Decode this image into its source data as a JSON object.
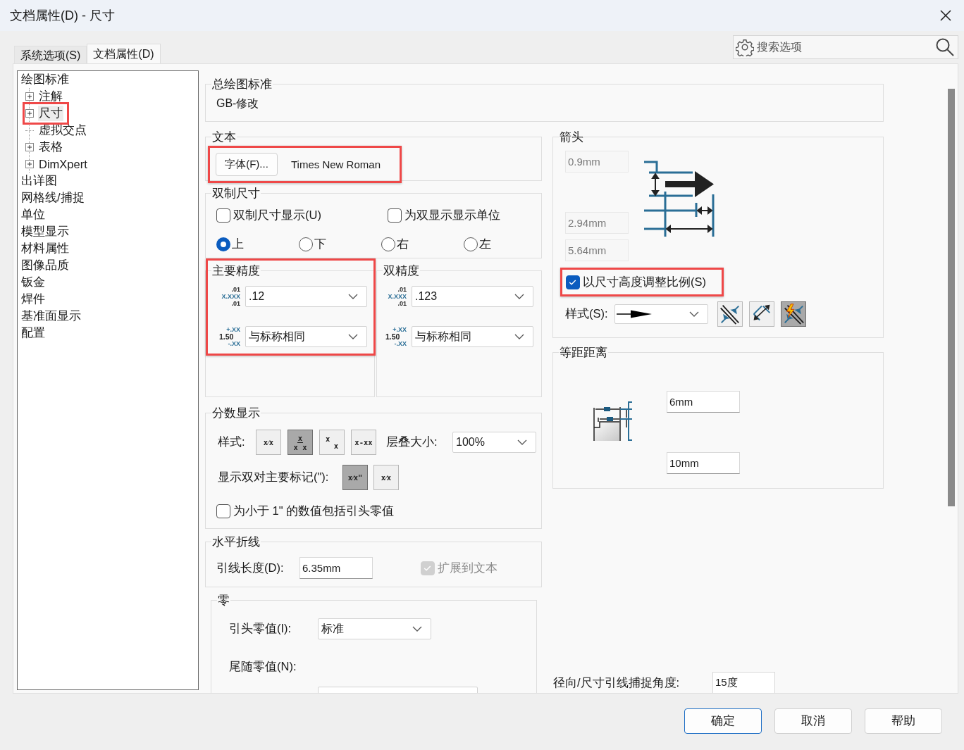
{
  "window": {
    "title": "文档属性(D) - 尺寸"
  },
  "tabs": [
    {
      "label": "系统选项(S)",
      "selected": false
    },
    {
      "label": "文档属性(D)",
      "selected": true
    }
  ],
  "search": {
    "placeholder": "搜索选项"
  },
  "tree": {
    "items": [
      {
        "label": "绘图标准",
        "expandable": false,
        "selected": false,
        "highlighted": false,
        "children": [
          {
            "label": "注解",
            "expandable": true,
            "selected": false,
            "highlighted": false
          },
          {
            "label": "尺寸",
            "expandable": true,
            "selected": true,
            "highlighted": true
          },
          {
            "label": "虚拟交点",
            "expandable": false,
            "selected": false,
            "highlighted": false
          },
          {
            "label": "表格",
            "expandable": true,
            "selected": false,
            "highlighted": false
          },
          {
            "label": "DimXpert",
            "expandable": true,
            "selected": false,
            "highlighted": false
          }
        ]
      },
      {
        "label": "出详图",
        "expandable": false,
        "selected": false,
        "highlighted": false
      },
      {
        "label": "网格线/捕捉",
        "expandable": false,
        "selected": false,
        "highlighted": false
      },
      {
        "label": "单位",
        "expandable": false,
        "selected": false,
        "highlighted": false
      },
      {
        "label": "模型显示",
        "expandable": false,
        "selected": false,
        "highlighted": false
      },
      {
        "label": "材料属性",
        "expandable": false,
        "selected": false,
        "highlighted": false
      },
      {
        "label": "图像品质",
        "expandable": false,
        "selected": false,
        "highlighted": false
      },
      {
        "label": "钣金",
        "expandable": false,
        "selected": false,
        "highlighted": false
      },
      {
        "label": "焊件",
        "expandable": false,
        "selected": false,
        "highlighted": false
      },
      {
        "label": "基准面显示",
        "expandable": false,
        "selected": false,
        "highlighted": false
      },
      {
        "label": "配置",
        "expandable": false,
        "selected": false,
        "highlighted": false
      }
    ]
  },
  "general_standard": {
    "title": "总绘图标准",
    "value": "GB-修改"
  },
  "text": {
    "title": "文本",
    "font_button": "字体(F)...",
    "font_name": "Times New Roman",
    "highlighted": true
  },
  "dual_dimensions": {
    "title": "双制尺寸",
    "checkboxes": [
      {
        "label": "双制尺寸显示(U)",
        "checked": false
      },
      {
        "label": "为双显示显示单位",
        "checked": false
      }
    ],
    "positions": [
      {
        "label": "上",
        "selected": true
      },
      {
        "label": "下",
        "selected": false
      },
      {
        "label": "右",
        "selected": false
      },
      {
        "label": "左",
        "selected": false
      }
    ]
  },
  "precision": [
    {
      "title": "主要精度",
      "highlighted": true,
      "value_icon": [
        ".01",
        "X.XXX",
        ".01"
      ],
      "value": ".12",
      "tolerance_icon": [
        "+.XX",
        "1.50",
        "-.XX"
      ],
      "tolerance": "与标称相同"
    },
    {
      "title": "双精度",
      "highlighted": false,
      "value_icon": [
        ".01",
        "X.XXX",
        ".01"
      ],
      "value": ".123",
      "tolerance_icon": [
        "+.XX",
        "1.50",
        "-.XX"
      ],
      "tolerance": "与标称相同"
    }
  ],
  "fractions": {
    "title": "分数显示",
    "style_label": "样式:",
    "styles": [
      {
        "kind": "inline",
        "label": "x⁄x",
        "selected": false
      },
      {
        "kind": "stacked",
        "top": "x",
        "bottom": "x x",
        "selected": true
      },
      {
        "kind": "diagonal",
        "top": "x",
        "bottom": "x",
        "selected": false
      },
      {
        "kind": "inline",
        "label": "x-xx",
        "selected": false
      }
    ],
    "stack_label": "层叠大小:",
    "stack_size": "100%",
    "mark_label": "显示双对主要标记(\"):",
    "marks": [
      {
        "label": "x⁄x\"",
        "selected": true
      },
      {
        "label": "x⁄x",
        "selected": false
      }
    ],
    "leading_zero": {
      "label": "为小于 1\" 的数值包括引头零值",
      "checked": false
    }
  },
  "leader": {
    "title": "水平折线",
    "length_label": "引线长度(D):",
    "length": "6.35mm",
    "extend": {
      "label": "扩展到文本",
      "checked": true,
      "disabled": true
    }
  },
  "zeros": {
    "title": "零",
    "rows": [
      {
        "kind": "dropdown",
        "label": "引头零值(I):",
        "value": "标准"
      },
      {
        "kind": "label",
        "label": "尾随零值(N):"
      },
      {
        "kind": "cut"
      }
    ]
  },
  "arrows": {
    "title": "箭头",
    "sizes": [
      "0.9mm",
      "2.94mm",
      "5.64mm"
    ],
    "scale": {
      "label": "以尺寸高度调整比例(S)",
      "checked": true,
      "highlighted": true
    },
    "style_label": "样式(S):",
    "placements": [
      {
        "kind": "outside",
        "selected": false
      },
      {
        "kind": "inside",
        "selected": false
      },
      {
        "kind": "smart",
        "selected": true
      }
    ]
  },
  "offset": {
    "title": "等距距离",
    "values": [
      "6mm",
      "10mm"
    ]
  },
  "snap": {
    "label": "径向/尺寸引线捕捉角度:",
    "value": "15度"
  },
  "buttons": [
    {
      "label": "确定",
      "default": true
    },
    {
      "label": "取消",
      "default": false
    },
    {
      "label": "帮助",
      "default": false
    }
  ]
}
